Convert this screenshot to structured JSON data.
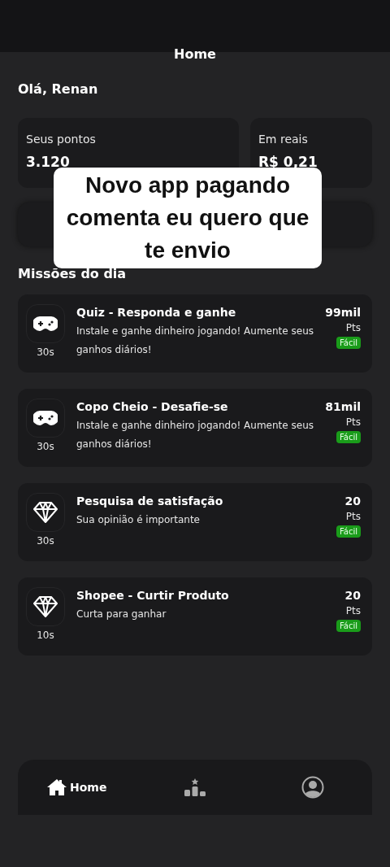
{
  "header": {
    "title": "Home"
  },
  "greeting": "Olá, Renan",
  "stats": [
    {
      "label": "Seus pontos",
      "value": "3.120"
    },
    {
      "label": "Em reais",
      "value": "R$ 0,21"
    }
  ],
  "caption": "Novo app pagando comenta eu quero que te envio",
  "missions_title": "Missões do dia",
  "missions": [
    {
      "kind": "gamepad",
      "title": "Quiz - Responda e ganhe",
      "description": "Instale e ganhe dinheiro jogando! Aumente seus ganhos diários!",
      "duration": "30s",
      "points": "99mil",
      "unit": "Pts",
      "difficulty": "Fácil",
      "color": "#1a9c1a"
    },
    {
      "kind": "gamepad",
      "title": "Copo Cheio - Desafie-se",
      "description": "Instale e ganhe dinheiro jogando! Aumente seus ganhos diários!",
      "duration": "30s",
      "points": "81mil",
      "unit": "Pts",
      "difficulty": "Fácil",
      "color": "#1a9c1a"
    },
    {
      "kind": "diamond",
      "title": "Pesquisa de satisfação",
      "description": "Sua opinião é importante",
      "duration": "30s",
      "points": "20",
      "unit": "Pts",
      "difficulty": "Fácil",
      "color": "#1a9c1a"
    },
    {
      "kind": "diamond",
      "title": "Shopee - Curtir Produto",
      "description": "Curta para ganhar",
      "duration": "10s",
      "points": "20",
      "unit": "Pts",
      "difficulty": "Fácil",
      "color": "#1a9c1a"
    }
  ],
  "nav": [
    {
      "kind": "home",
      "label": "Home",
      "selected": true
    },
    {
      "kind": "ranking",
      "selected": false
    },
    {
      "kind": "profile",
      "selected": false
    }
  ]
}
